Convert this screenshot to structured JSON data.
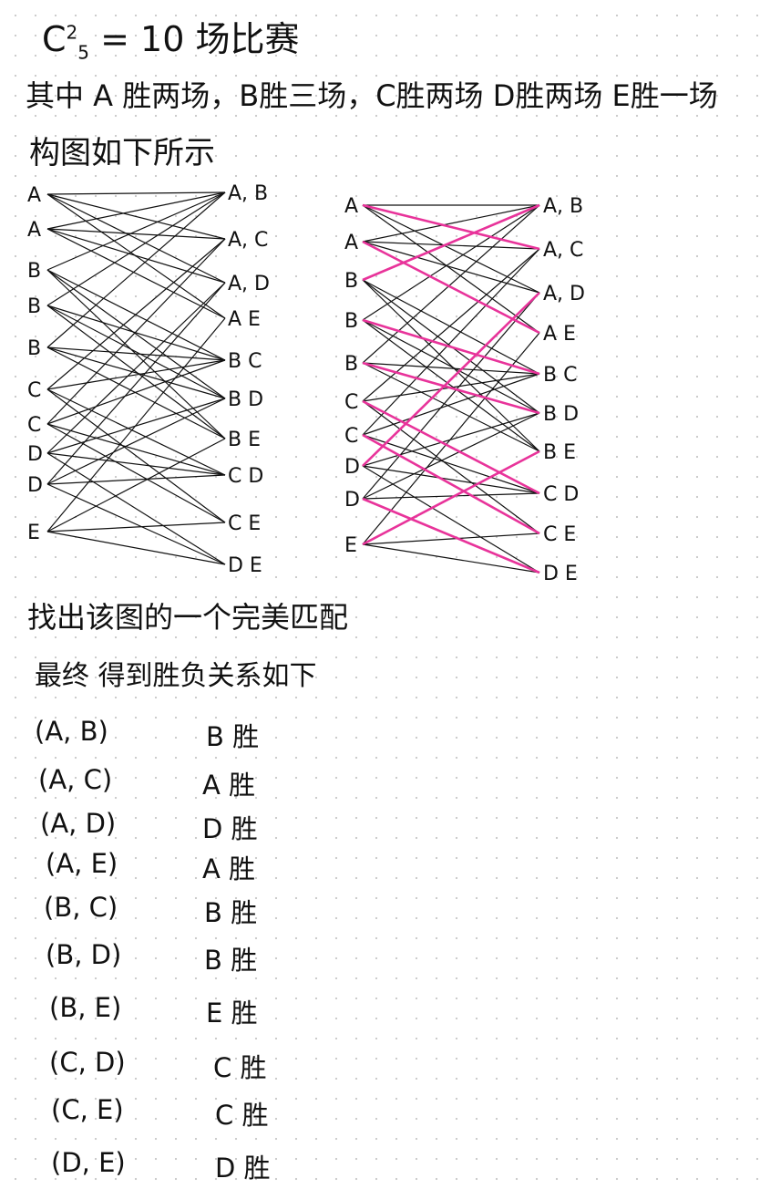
{
  "header": {
    "c": "C",
    "sup": "2",
    "sub": "5",
    "rest": "= 10 场比赛",
    "line2": "其中 A 胜两场，B胜三场，C胜两场 D胜两场 E胜一场",
    "line3": "构图如下所示"
  },
  "graph_left": {
    "left_nodes": [
      "A",
      "A",
      "B",
      "B",
      "B",
      "C",
      "C",
      "D",
      "D",
      "E"
    ],
    "right_nodes": [
      "A, B",
      "A, C",
      "A, D",
      "A  E",
      "B  C",
      "B  D",
      "B  E",
      "C  D",
      "C  E",
      "D E"
    ]
  },
  "graph_right": {
    "left_nodes": [
      "A",
      "A",
      "B",
      "B",
      "B",
      "C",
      "C",
      "D",
      "D",
      "E"
    ],
    "right_nodes": [
      "A, B",
      "A, C",
      "A, D",
      "A  E",
      "B  C",
      "B  D",
      "B  E",
      "C  D",
      "C  E",
      "D E"
    ],
    "match_color": "#e8339a",
    "edge_color": "#111111",
    "perfect_matching": [
      [
        "A",
        "A, C"
      ],
      [
        "A",
        "A  E"
      ],
      [
        "B",
        "A, B"
      ],
      [
        "B",
        "B  C"
      ],
      [
        "B",
        "B  D"
      ],
      [
        "C",
        "C  D"
      ],
      [
        "C",
        "C  E"
      ],
      [
        "D",
        "A, D"
      ],
      [
        "D",
        "D E"
      ],
      [
        "E",
        "B  E"
      ]
    ]
  },
  "find_label": "找出该图的一个完美匹配",
  "final_label": "最终 得到胜负关系如下",
  "results": [
    {
      "pair": "(A, B)",
      "winner": "B 胜"
    },
    {
      "pair": "(A, C)",
      "winner": "A 胜"
    },
    {
      "pair": "(A, D)",
      "winner": "D 胜"
    },
    {
      "pair": "(A, E)",
      "winner": "A 胜"
    },
    {
      "pair": "(B, C)",
      "winner": "B 胜"
    },
    {
      "pair": "(B, D)",
      "winner": "B 胜"
    },
    {
      "pair": "(B, E)",
      "winner": "E 胜"
    },
    {
      "pair": "(C, D)",
      "winner": "C 胜"
    },
    {
      "pair": "(C, E)",
      "winner": "C 胜"
    },
    {
      "pair": "(D, E)",
      "winner": "D 胜"
    }
  ]
}
